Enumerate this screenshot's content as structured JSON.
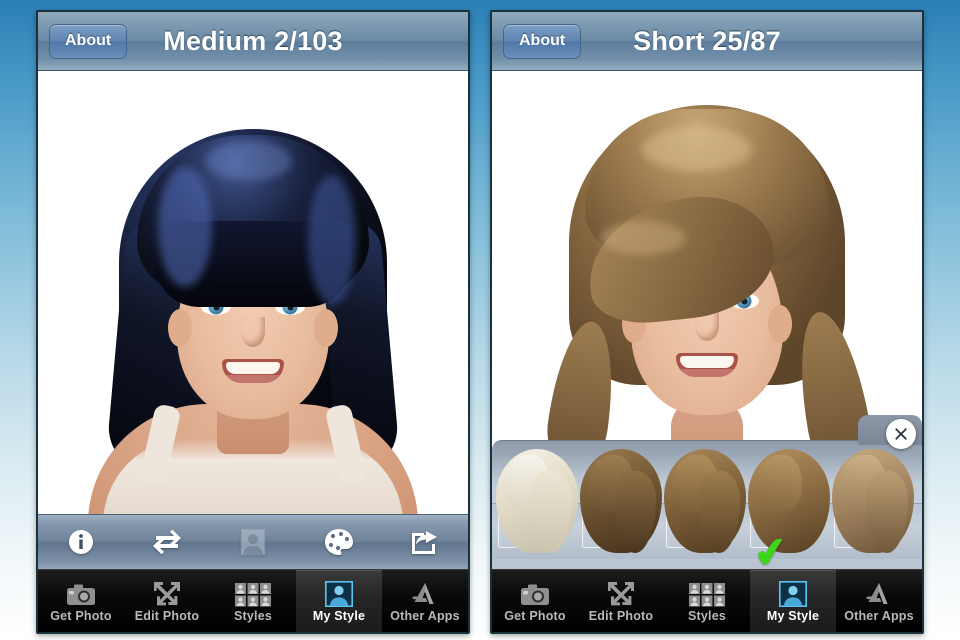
{
  "app": {
    "background_top_color": "#2a7fb5",
    "background_bottom_color": "#ffffff"
  },
  "panels": [
    {
      "id": "left",
      "navbar": {
        "about_label": "About",
        "title": "Medium 2/103"
      },
      "photo": {
        "description": "Woman with black and blue medium bob hairstyle with blunt bangs",
        "hair_color": "#0a0c16",
        "hair_highlight_color": "#3a4f86",
        "skin_color": "#e8bb9d",
        "eye_color": "#4f8fb6",
        "garment_color": "#efe7de"
      },
      "toolbar": [
        {
          "name": "info-icon",
          "label": "Info"
        },
        {
          "name": "swap-icon",
          "label": "Swap"
        },
        {
          "name": "portrait-icon",
          "label": "Portrait",
          "dimmed": true
        },
        {
          "name": "palette-icon",
          "label": "Hair Color"
        },
        {
          "name": "share-icon",
          "label": "Share"
        }
      ],
      "color_panel_visible": false
    },
    {
      "id": "right",
      "navbar": {
        "about_label": "About",
        "title": "Short 25/87"
      },
      "photo": {
        "description": "Woman with short layered light brown hairstyle with side-swept bangs",
        "hair_color": "#8a6a42",
        "hair_highlight_color": "#c8a877",
        "skin_color": "#e8bb9d",
        "eye_color": "#4f8fb6",
        "garment_color": "#efe7de"
      },
      "toolbar": [],
      "color_panel_visible": true,
      "color_panel": {
        "close_label": "Close",
        "selected_index": 3,
        "check_mark": "✔",
        "check_color": "#3fd51b",
        "swatches": [
          {
            "name": "platinum-blonde",
            "base": "#d9d2bd",
            "light": "#f3efe2",
            "dark": "#b9b19a"
          },
          {
            "name": "dark-brown",
            "base": "#6a4f2f",
            "light": "#9a7a4f",
            "dark": "#3f2d18"
          },
          {
            "name": "medium-brown",
            "base": "#7d5f3a",
            "light": "#ad8b5b",
            "dark": "#4d3820"
          },
          {
            "name": "warm-brown",
            "base": "#8a6a42",
            "light": "#b89363",
            "dark": "#533c22"
          },
          {
            "name": "light-golden-brown",
            "base": "#a08260",
            "light": "#c9ab80",
            "dark": "#6b5337"
          }
        ]
      }
    }
  ],
  "tabbar": {
    "selected": "My Style",
    "tabs": [
      {
        "label": "Get Photo",
        "icon": "camera-icon"
      },
      {
        "label": "Edit Photo",
        "icon": "resize-arrows-icon"
      },
      {
        "label": "Styles",
        "icon": "people-grid-icon"
      },
      {
        "label": "My Style",
        "icon": "portrait-icon"
      },
      {
        "label": "Other Apps",
        "icon": "app-store-icon"
      }
    ]
  }
}
